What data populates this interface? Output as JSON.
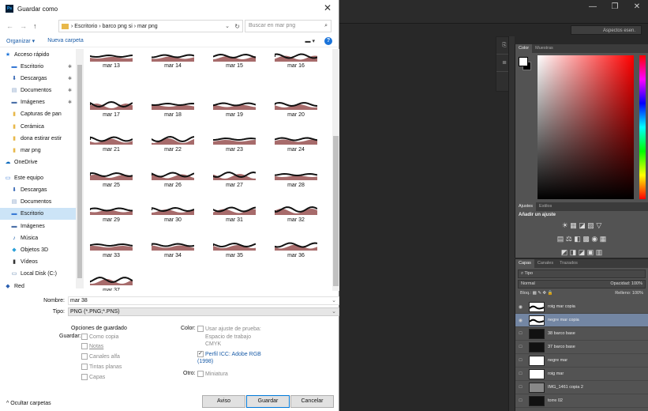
{
  "dialog": {
    "title": "Guardar como",
    "close_icon": "✕",
    "nav": {
      "back": "←",
      "forward": "→",
      "up": "↑",
      "path": "› Escritorio › barco png si › mar png",
      "search_placeholder": "Buscar en mar png"
    },
    "toolbar": {
      "organize": "Organizar ▾",
      "new_folder": "Nueva carpeta"
    },
    "sidebar": [
      {
        "label": "Acceso rápido",
        "icon": "star-icon",
        "pinned": false,
        "color": "#1a73d9"
      },
      {
        "label": "Escritorio",
        "icon": "desktop-icon",
        "pinned": true,
        "color": "#3a7bd5"
      },
      {
        "label": "Descargas",
        "icon": "download-icon",
        "pinned": true,
        "color": "#2b5fb0"
      },
      {
        "label": "Documentos",
        "icon": "document-icon",
        "pinned": true,
        "color": "#8aa6c9"
      },
      {
        "label": "Imágenes",
        "icon": "image-icon",
        "pinned": true,
        "color": "#4a6fa8"
      },
      {
        "label": "Capturas de pan",
        "icon": "folder-icon",
        "pinned": false,
        "color": "#e8b84a"
      },
      {
        "label": "Cerámica",
        "icon": "folder-icon",
        "pinned": false,
        "color": "#e8b84a"
      },
      {
        "label": "dona estirar estir",
        "icon": "folder-icon",
        "pinned": false,
        "color": "#e8b84a"
      },
      {
        "label": "mar png",
        "icon": "folder-icon",
        "pinned": false,
        "color": "#e8b84a"
      },
      {
        "label": "OneDrive",
        "icon": "cloud-icon",
        "pinned": false,
        "color": "#0f6cbd"
      },
      {
        "label": "Este equipo",
        "icon": "computer-icon",
        "pinned": false,
        "color": "#3a7bd5"
      },
      {
        "label": "Descargas",
        "icon": "download-icon",
        "pinned": false,
        "color": "#2b5fb0"
      },
      {
        "label": "Documentos",
        "icon": "document-icon",
        "pinned": false,
        "color": "#8aa6c9"
      },
      {
        "label": "Escritorio",
        "icon": "desktop-icon",
        "pinned": false,
        "color": "#3a7bd5",
        "selected": true
      },
      {
        "label": "Imágenes",
        "icon": "image-icon",
        "pinned": false,
        "color": "#4a6fa8"
      },
      {
        "label": "Música",
        "icon": "music-icon",
        "pinned": false,
        "color": "#1a5ca8"
      },
      {
        "label": "Objetos 3D",
        "icon": "cube-icon",
        "pinned": false,
        "color": "#2ba0d8"
      },
      {
        "label": "Vídeos",
        "icon": "video-icon",
        "pinned": false,
        "color": "#333333"
      },
      {
        "label": "Local Disk (C:)",
        "icon": "disk-icon",
        "pinned": false,
        "color": "#5a7fa8"
      },
      {
        "label": "Red",
        "icon": "network-icon",
        "pinned": false,
        "color": "#2b5fb0"
      }
    ],
    "files": [
      "mar 13",
      "mar 14",
      "mar 15",
      "mar 16",
      "mar 17",
      "mar 18",
      "mar 19",
      "mar 20",
      "mar 21",
      "mar 22",
      "mar 23",
      "mar 24",
      "mar 25",
      "mar 26",
      "mar 27",
      "mar 28",
      "mar 29",
      "mar 30",
      "mar 31",
      "mar 32",
      "mar 33",
      "mar 34",
      "mar 35",
      "mar 36",
      "mar 37"
    ],
    "fields": {
      "name_label": "Nombre:",
      "name_value": "mar 38",
      "type_label": "Tipo:",
      "type_value": "PNG (*.PNG;*.PNS)"
    },
    "options": {
      "title": "Opciones de guardado",
      "save_label": "Guardar:",
      "as_copy": "Como copia",
      "notes": "Notas",
      "alpha": "Canales alfa",
      "spot": "Tintas planas",
      "layers": "Capas",
      "color_label": "Color:",
      "proof": "Usar ajuste de prueba:",
      "proof_sub": "Espacio de trabajo CMYK",
      "icc": "Perfil ICC: Adobe RGB (1998)",
      "icc_checked": true,
      "other_label": "Otro:",
      "thumb": "Miniatura"
    },
    "footer": {
      "hide_folders": "Ocultar carpetas",
      "warning": "Aviso",
      "save": "Guardar",
      "cancel": "Cancelar"
    }
  },
  "photoshop": {
    "workspace": "Aspectos esen.",
    "color_tabs": [
      "Color",
      "Muestras"
    ],
    "adjust_tabs": [
      "Ajustes",
      "Estilos"
    ],
    "adjust_title": "Añadir un ajuste",
    "layers_tabs": [
      "Capas",
      "Canales",
      "Trazados"
    ],
    "filter": "Tipo",
    "blend": "Normal",
    "opacity_label": "Opacidad:",
    "opacity": "100%",
    "lock_label": "Bloq.:",
    "fill_label": "Relleno:",
    "fill": "100%",
    "layers": [
      {
        "name": "roig mar copia",
        "thumb": "wave",
        "visible": true,
        "selected": false
      },
      {
        "name": "negre mar copia",
        "thumb": "wave",
        "visible": true,
        "selected": true
      },
      {
        "name": "38 barco base",
        "thumb": "dark",
        "visible": false,
        "selected": false
      },
      {
        "name": "37 barco base",
        "thumb": "dark",
        "visible": false,
        "selected": false
      },
      {
        "name": "negre mar",
        "thumb": "white",
        "visible": false,
        "selected": false
      },
      {
        "name": "roig mar",
        "thumb": "white",
        "visible": false,
        "selected": false
      },
      {
        "name": "IMG_1461 copia 2",
        "thumb": "gray",
        "visible": false,
        "selected": false
      },
      {
        "name": "torre 02",
        "thumb": "dark",
        "visible": false,
        "selected": false
      }
    ]
  }
}
